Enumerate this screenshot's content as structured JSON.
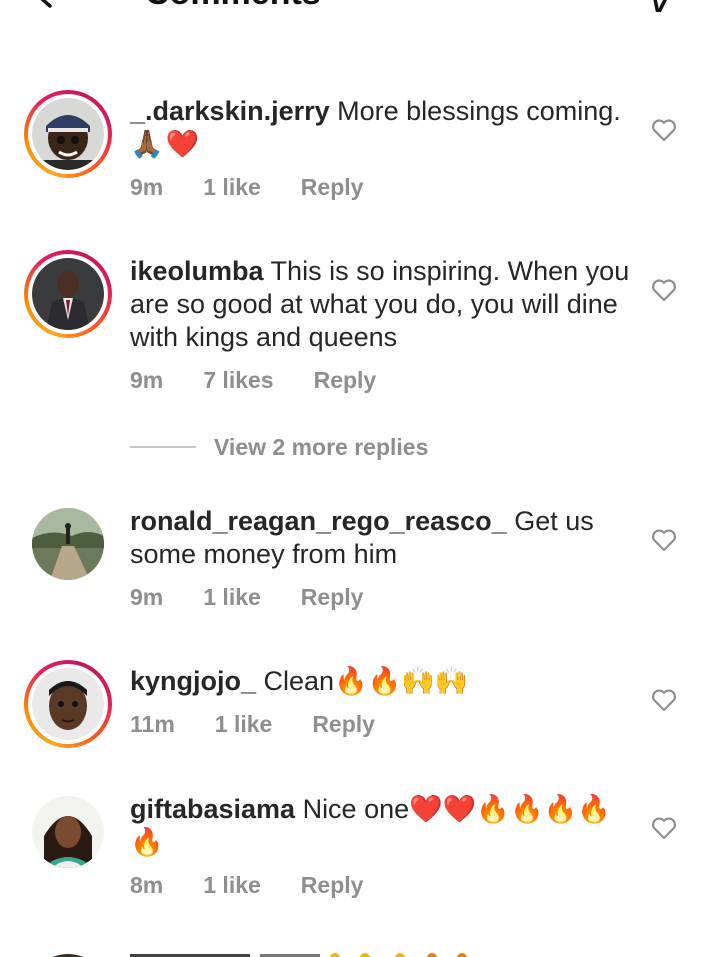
{
  "header": {
    "title": "Comments"
  },
  "comments": [
    {
      "username": "_.darkskin.jerry",
      "text": " More blessings coming.",
      "emoji": "🙏🏾❤️",
      "time": "9m",
      "likes": "1 like",
      "reply": "Reply"
    },
    {
      "username": "ikeolumba",
      "text": " This is so inspiring. When you are so good at what you do, you will dine with kings and queens",
      "time": "9m",
      "likes": "7 likes",
      "reply": "Reply"
    },
    {
      "username": "ronald_reagan_rego_reasco_",
      "text": " Get us some money from him",
      "time": "9m",
      "likes": "1 like",
      "reply": "Reply"
    },
    {
      "username": "kyngjojo_",
      "text": " Clean🔥🔥🙌🙌",
      "time": "11m",
      "likes": "1 like",
      "reply": "Reply"
    },
    {
      "username": "giftabasiama",
      "text": " Nice one❤️❤️🔥🔥🔥🔥",
      "emoji": "🔥",
      "time": "8m",
      "likes": "1 like",
      "reply": "Reply"
    }
  ],
  "view_more_replies": "View 2 more replies",
  "icons": {
    "back": "back-arrow-icon",
    "send": "send-icon",
    "like": "heart-outline-icon"
  },
  "colors": {
    "text": "#262626",
    "secondary": "#8e8e8e",
    "story_ring_start": "#f9a825",
    "story_ring_end": "#d81b60"
  }
}
